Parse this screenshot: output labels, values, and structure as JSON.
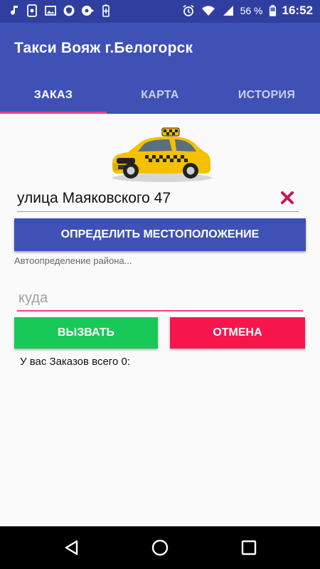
{
  "status_bar": {
    "icons_left": [
      "music-note-icon",
      "sd-card-icon",
      "image-icon",
      "shield-icon",
      "record-icon",
      "battery-plus-icon"
    ],
    "battery_percent": "56 %",
    "time": "16:52"
  },
  "app": {
    "title": "Такси Вояж г.Белогорск"
  },
  "tabs": [
    {
      "label": "ЗАКАЗ",
      "active": true
    },
    {
      "label": "КАРТА",
      "active": false
    },
    {
      "label": "ИСТОРИЯ",
      "active": false
    }
  ],
  "order": {
    "address_value": "улица Маяковского 47",
    "locate_button": "ОПРЕДЕЛИТЬ МЕСТОПОЛОЖЕНИЕ",
    "hint": "Автоопределение района...",
    "destination_placeholder": "куда",
    "destination_value": "",
    "call_button": "ВЫЗВАТЬ",
    "cancel_button": "ОТМЕНА",
    "orders_summary": "У вас Заказов всего 0:"
  },
  "colors": {
    "primary": "#3f51b5",
    "primary_dark": "#303f9f",
    "accent": "#ff4081",
    "call": "#19c957",
    "cancel": "#f6164b",
    "clear_icon": "#c2185b"
  }
}
